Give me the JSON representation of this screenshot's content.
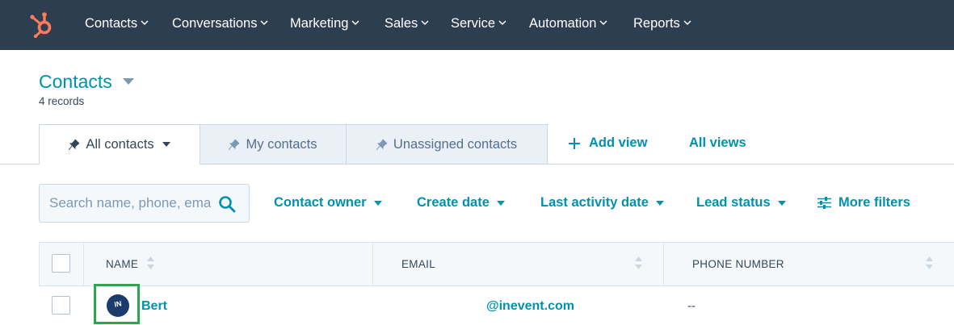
{
  "nav": {
    "items": [
      {
        "label": "Contacts"
      },
      {
        "label": "Conversations"
      },
      {
        "label": "Marketing"
      },
      {
        "label": "Sales"
      },
      {
        "label": "Service"
      },
      {
        "label": "Automation"
      },
      {
        "label": "Reports"
      }
    ]
  },
  "header": {
    "title": "Contacts",
    "records": "4 records"
  },
  "tabs": [
    {
      "label": "All contacts"
    },
    {
      "label": "My contacts"
    },
    {
      "label": "Unassigned contacts"
    }
  ],
  "actions": {
    "add_view": "Add view",
    "all_views": "All views"
  },
  "search": {
    "placeholder": "Search name, phone, email"
  },
  "filters": {
    "contact_owner": "Contact owner",
    "create_date": "Create date",
    "last_activity_date": "Last activity date",
    "lead_status": "Lead status",
    "more_filters": "More filters"
  },
  "table": {
    "columns": [
      "NAME",
      "EMAIL",
      "PHONE NUMBER"
    ],
    "rows": [
      {
        "name": "Bert",
        "email": "@inevent.com",
        "phone": "--",
        "avatar_text": "IN"
      }
    ]
  },
  "colors": {
    "nav_bg": "#2d3e50",
    "accent": "#0091ae",
    "logo": "#ff7a59",
    "highlight": "#2ea44f"
  }
}
